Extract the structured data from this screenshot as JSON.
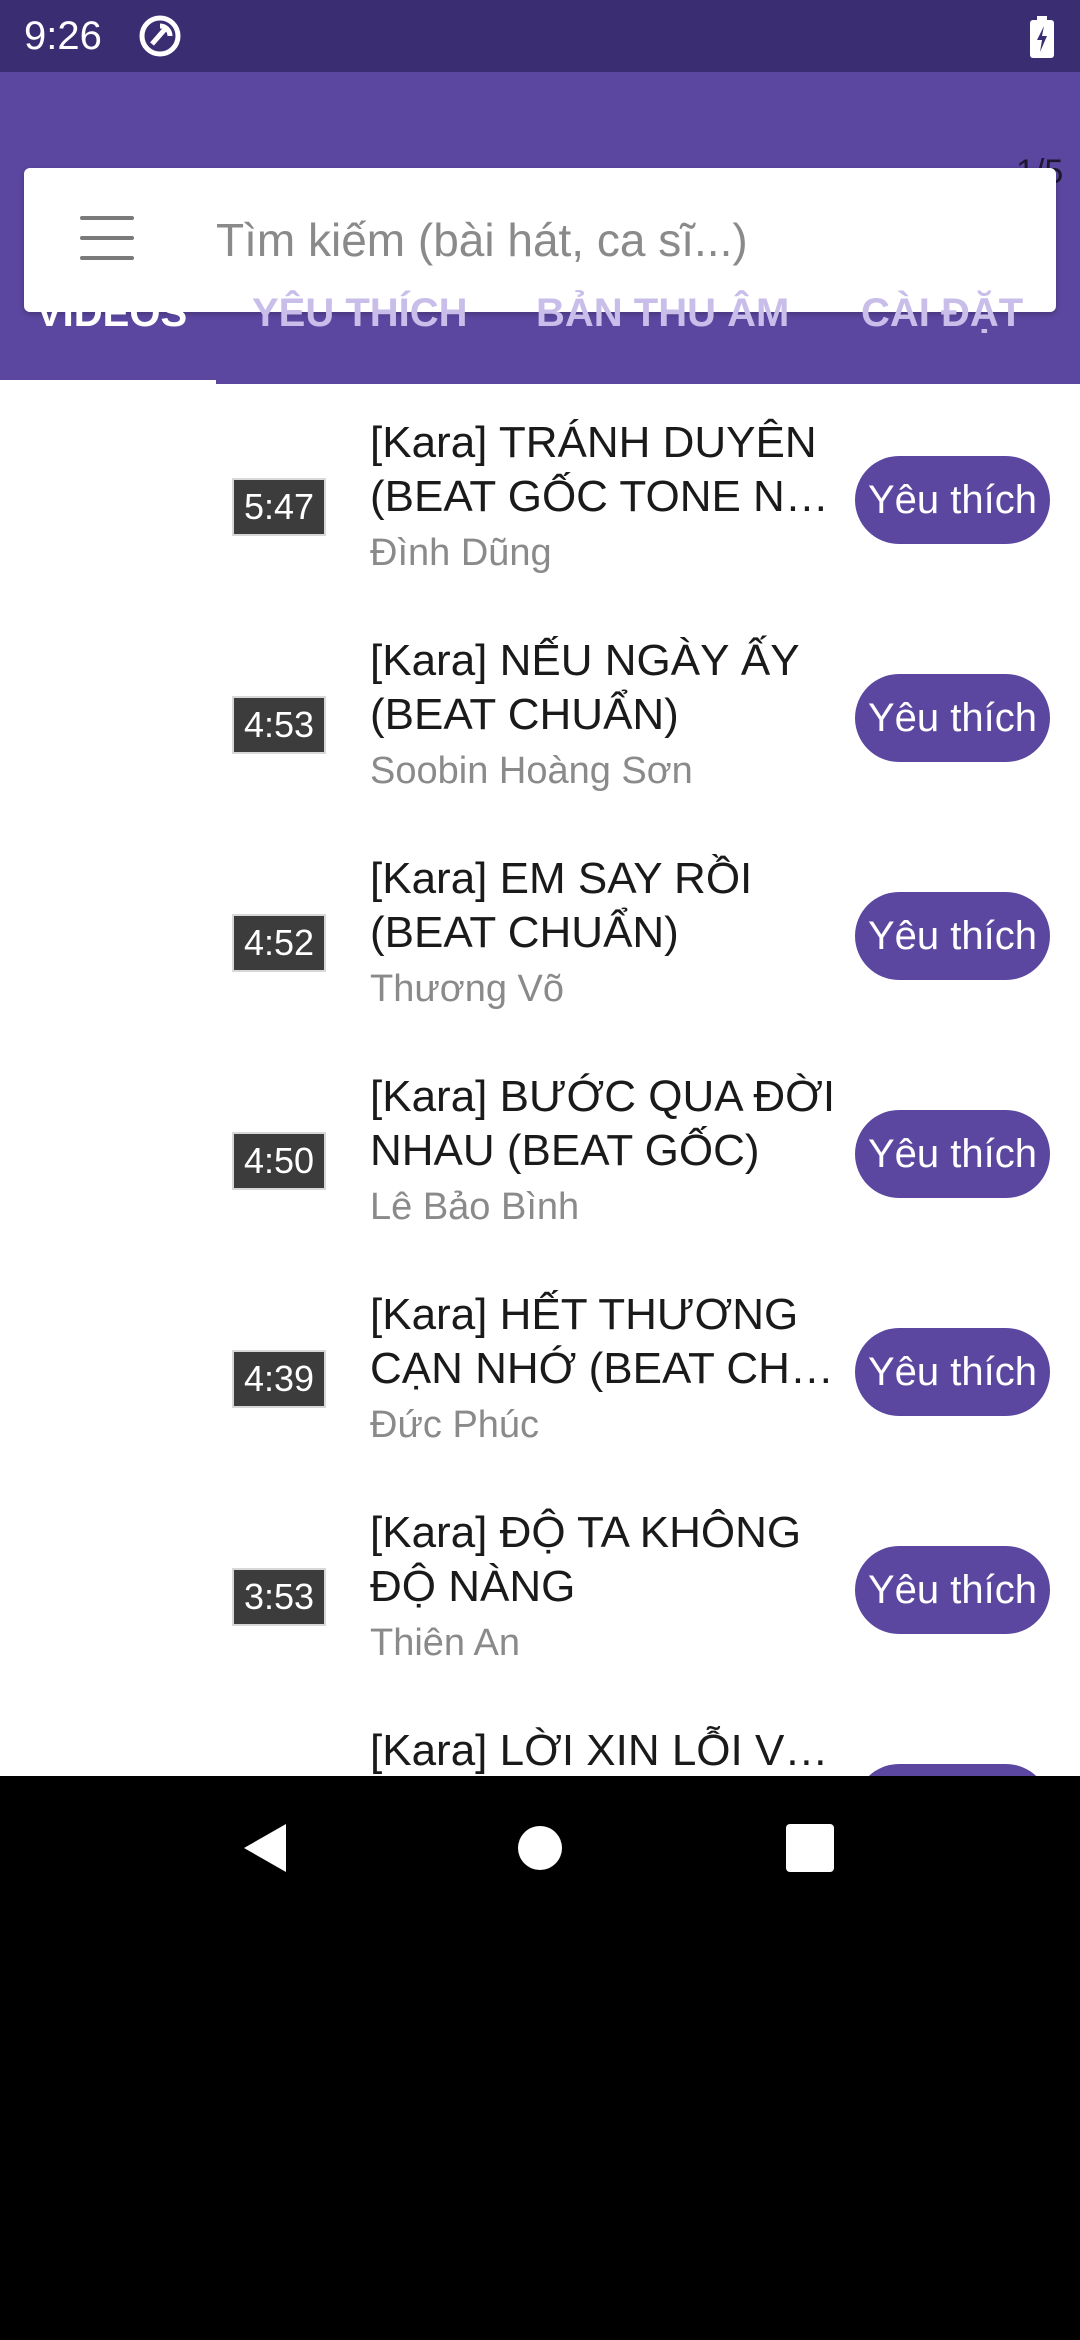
{
  "status": {
    "time": "9:26"
  },
  "pager": {
    "text": "1/5"
  },
  "search": {
    "placeholder": "Tìm kiếm (bài hát, ca sĩ...)"
  },
  "tabs": [
    {
      "label": "VIDEOS",
      "active": true
    },
    {
      "label": "YÊU THÍCH",
      "active": false
    },
    {
      "label": "BẢN THU ÂM",
      "active": false
    },
    {
      "label": "CÀI ĐẶT",
      "active": false
    }
  ],
  "items": [
    {
      "duration": "5:47",
      "title1": "[Kara] TRÁNH DUYÊN",
      "title2": "(BEAT GỐC TONE NAM)",
      "artist": "Đình Dũng",
      "button": "Yêu thích"
    },
    {
      "duration": "4:53",
      "title1": "[Kara] NẾU NGÀY ẤY",
      "title2": "(BEAT CHUẨN)",
      "artist": "Soobin Hoàng Sơn",
      "button": "Yêu thích"
    },
    {
      "duration": "4:52",
      "title1": "[Kara] EM SAY RỒI",
      "title2": "(BEAT CHUẨN)",
      "artist": "Thương Võ",
      "button": "Yêu thích"
    },
    {
      "duration": "4:50",
      "title1": "[Kara] BƯỚC QUA ĐỜI",
      "title2": "NHAU (BEAT GỐC)",
      "artist": "Lê Bảo Bình",
      "button": "Yêu thích"
    },
    {
      "duration": "4:39",
      "title1": "[Kara] HẾT THƯƠNG",
      "title2": "CẠN NHỚ (BEAT CHU...",
      "artist": "Đức Phúc",
      "button": "Yêu thích"
    },
    {
      "duration": "3:53",
      "title1": "[Kara] ĐỘ TA KHÔNG",
      "title2": "ĐỘ NÀNG",
      "artist": "Thiên An",
      "button": "Yêu thích"
    },
    {
      "duration": "",
      "title1": "[Kara] LỜI XIN LỖI VỤNG",
      "title2": "",
      "artist": "",
      "button": ""
    }
  ],
  "colors": {
    "primary": "#5b47a0",
    "statusbar": "#3b2d72"
  }
}
